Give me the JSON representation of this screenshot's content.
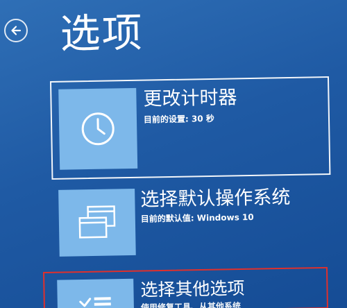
{
  "header": {
    "back_icon": "arrow-left-circle-icon",
    "title": "选项"
  },
  "options": [
    {
      "icon": "clock-icon",
      "title": "更改计时器",
      "subtitle": "目前的设置: 30 秒"
    },
    {
      "icon": "windows-stack-icon",
      "title": "选择默认操作系统",
      "subtitle": "目前的默认值: Windows 10"
    },
    {
      "icon": "check-list-icon",
      "title": "选择其他选项",
      "subtitle": "使用修复工具、从其他系统"
    }
  ],
  "colors": {
    "background": "#1f5aa4",
    "tile": "#7db8ea",
    "highlight_frame": "#ffffff",
    "annotation_frame": "#e0302c"
  }
}
